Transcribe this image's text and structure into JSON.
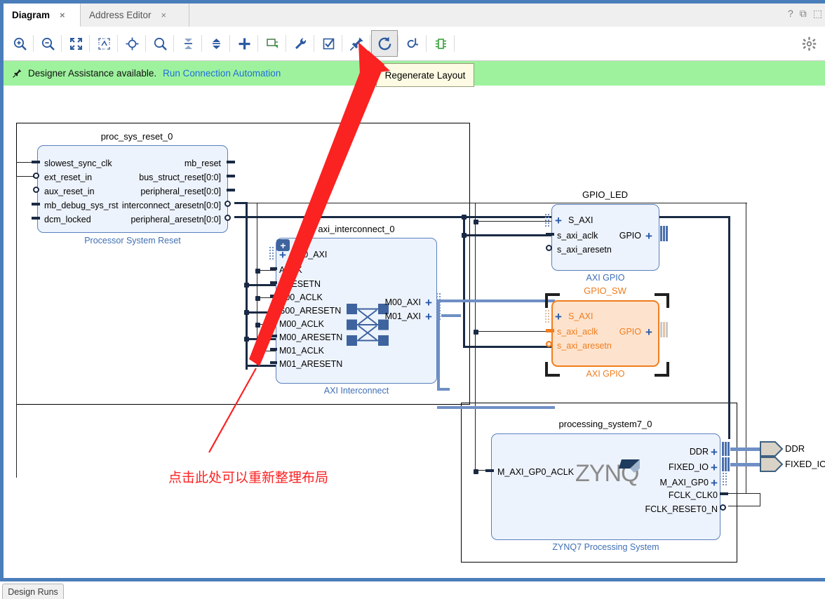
{
  "window": {
    "tabs": [
      {
        "label": "Diagram",
        "active": true,
        "close": "×"
      },
      {
        "label": "Address Editor",
        "active": false,
        "close": "×"
      }
    ],
    "controls": [
      {
        "name": "help-icon",
        "glyph": "?"
      },
      {
        "name": "restore-icon",
        "glyph": "⧉"
      },
      {
        "name": "close-panel-icon",
        "glyph": "⬚"
      }
    ]
  },
  "toolbar": {
    "buttons": [
      {
        "name": "zoom-in-icon",
        "tip": "Zoom In"
      },
      {
        "name": "zoom-out-icon",
        "tip": "Zoom Out"
      },
      {
        "name": "zoom-fit-icon",
        "tip": "Zoom Fit"
      },
      {
        "name": "zoom-area-icon",
        "tip": "Zoom Area"
      },
      {
        "name": "fit-selection-icon",
        "tip": "Fit Selection"
      },
      {
        "name": "search-icon",
        "tip": "Search"
      },
      {
        "name": "collapse-all-icon",
        "tip": "Collapse All"
      },
      {
        "name": "expand-all-icon",
        "tip": "Expand All"
      },
      {
        "name": "add-ip-icon",
        "tip": "Add IP"
      },
      {
        "name": "create-hierarchy-icon",
        "tip": "Create Hierarchy"
      },
      {
        "name": "run-block-automation-icon",
        "tip": "Run Block Automation"
      },
      {
        "name": "validate-design-icon",
        "tip": "Validate Design"
      },
      {
        "name": "pin-icon",
        "tip": "Pin"
      },
      {
        "name": "regenerate-layout-icon",
        "tip": "Regenerate Layout",
        "selected": true
      },
      {
        "name": "optimize-routing-icon",
        "tip": "Optimize Routing"
      },
      {
        "name": "highlight-icon",
        "tip": "Highlight"
      }
    ],
    "settings": {
      "name": "gear-icon",
      "tip": "Settings"
    }
  },
  "banner": {
    "icon": "pin-icon",
    "message": "Designer Assistance available.",
    "link": "Run Connection Automation"
  },
  "tooltip": {
    "text": "Regenerate Layout"
  },
  "annotation": {
    "text": "点击此处可以重新整理布局",
    "color": "#fb2222"
  },
  "bottom": {
    "tab_label": "Design Runs"
  },
  "colors": {
    "block_fill_blue": "#edf3fc",
    "block_border_blue": "#5a7fbd",
    "block_fill_orange": "#fde3cd",
    "block_border_orange": "#f07d20",
    "wire_dark": "#1a2a44",
    "wire_bus": "#6f8fc4",
    "banner_green": "#9ef29e",
    "link_blue": "#1e6fd9",
    "frame_blue": "#4a7ebb"
  },
  "diagram": {
    "blocks": [
      {
        "id": "proc_sys_reset_0",
        "title": "proc_sys_reset_0",
        "subtitle": "Processor System Reset",
        "selected": false,
        "inputs": [
          "slowest_sync_clk",
          "ext_reset_in",
          "aux_reset_in",
          "mb_debug_sys_rst",
          "dcm_locked"
        ],
        "outputs": [
          "mb_reset",
          "bus_struct_reset[0:0]",
          "peripheral_reset[0:0]",
          "interconnect_aresetn[0:0]",
          "peripheral_aresetn[0:0]"
        ]
      },
      {
        "id": "axi_interconnect_0",
        "title": "axi_interconnect_0",
        "subtitle": "AXI Interconnect",
        "selected": false,
        "inputs": [
          "S00_AXI",
          "ACLK",
          "ARESETN",
          "S00_ACLK",
          "S00_ARESETN",
          "M00_ACLK",
          "M00_ARESETN",
          "M01_ACLK",
          "M01_ARESETN"
        ],
        "outputs": [
          "M00_AXI",
          "M01_AXI"
        ]
      },
      {
        "id": "GPIO_LED",
        "title": "GPIO_LED",
        "subtitle": "AXI GPIO",
        "selected": false,
        "inputs": [
          "S_AXI",
          "s_axi_aclk",
          "s_axi_aresetn"
        ],
        "outputs": [
          "GPIO"
        ]
      },
      {
        "id": "GPIO_SW",
        "title": "GPIO_SW",
        "subtitle": "AXI GPIO",
        "selected": true,
        "inputs": [
          "S_AXI",
          "s_axi_aclk",
          "s_axi_aresetn"
        ],
        "outputs": [
          "GPIO"
        ]
      },
      {
        "id": "processing_system7_0",
        "title": "processing_system7_0",
        "subtitle": "ZYNQ7 Processing System",
        "selected": false,
        "logo": "ZYNQ.",
        "inputs": [
          "M_AXI_GP0_ACLK"
        ],
        "outputs": [
          "DDR",
          "FIXED_IO",
          "M_AXI_GP0",
          "FCLK_CLK0",
          "FCLK_RESET0_N"
        ]
      }
    ],
    "external_ports": [
      {
        "name": "DDR"
      },
      {
        "name": "FIXED_IO"
      }
    ]
  }
}
